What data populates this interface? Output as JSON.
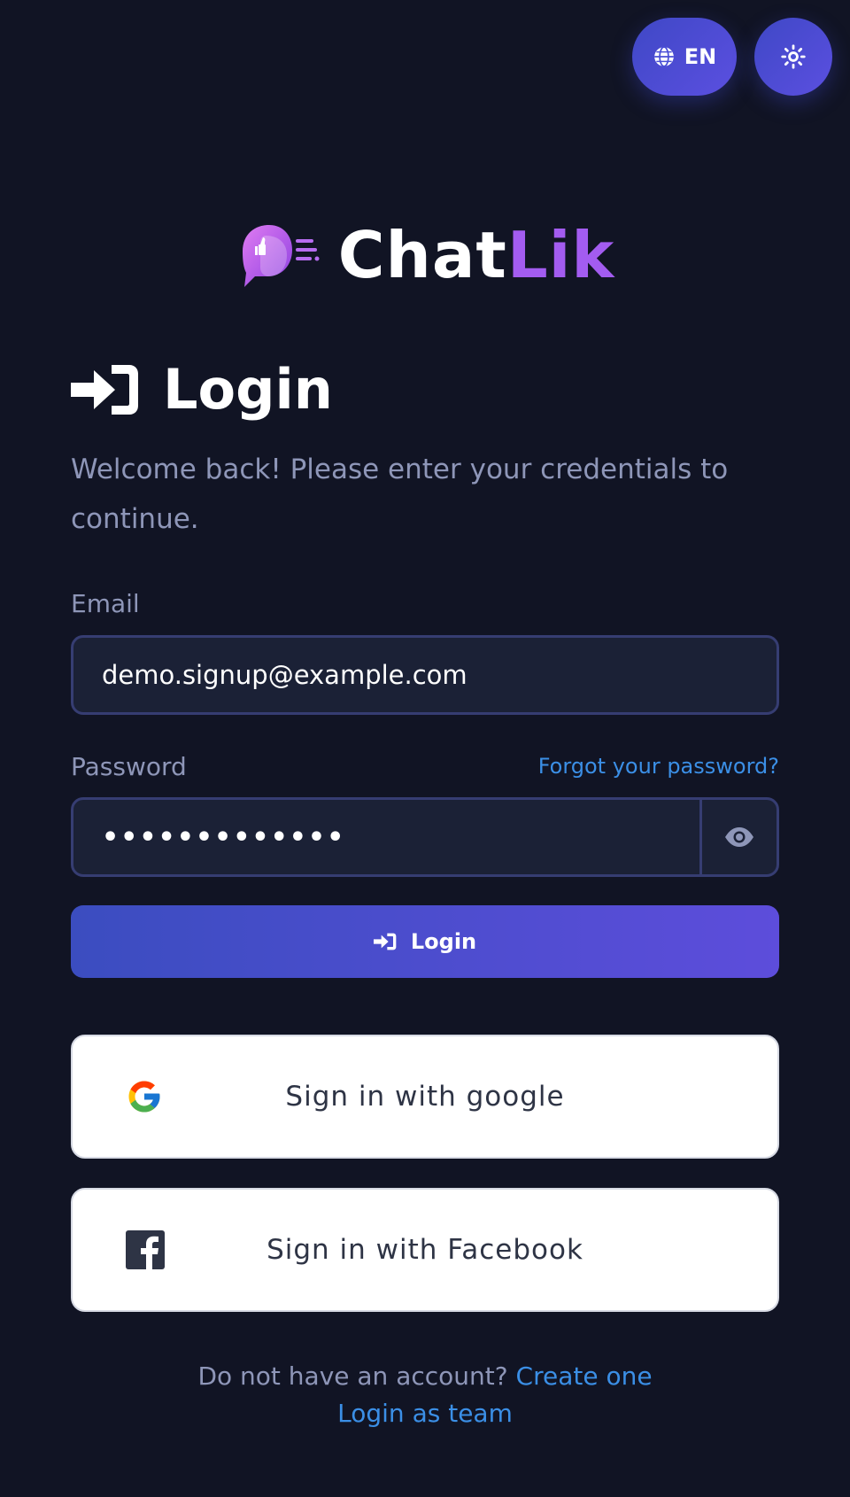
{
  "header": {
    "language_label": "EN",
    "language_icon": "globe-icon",
    "theme_icon": "sun-icon"
  },
  "logo": {
    "name_part1": "Chat",
    "name_part2": "Lik",
    "icon": "chat-bubble-thumbs-up-logo",
    "colors": {
      "part1": "#ffffff",
      "part2": "#a35cf0"
    }
  },
  "login": {
    "title": "Login",
    "title_icon": "sign-in-icon",
    "subtitle": "Welcome back! Please enter your credentials to continue.",
    "email_label": "Email",
    "email_value": "demo.signup@example.com",
    "password_label": "Password",
    "password_value": "•••••••••••••",
    "forgot_label": "Forgot your password?",
    "show_password_icon": "eye-icon",
    "submit_label": "Login",
    "google_label": "Sign in with google",
    "facebook_label": "Sign in with Facebook",
    "no_account_text": "Do not have an account?",
    "create_label": "Create one",
    "team_label": "Login as team"
  },
  "colors": {
    "background": "#111424",
    "accent_start": "#3b4dc0",
    "accent_end": "#5d4ddb",
    "link": "#3b8fe6",
    "muted_text": "#8e96b8",
    "input_bg": "#1b2136",
    "input_border": "#363d72"
  }
}
